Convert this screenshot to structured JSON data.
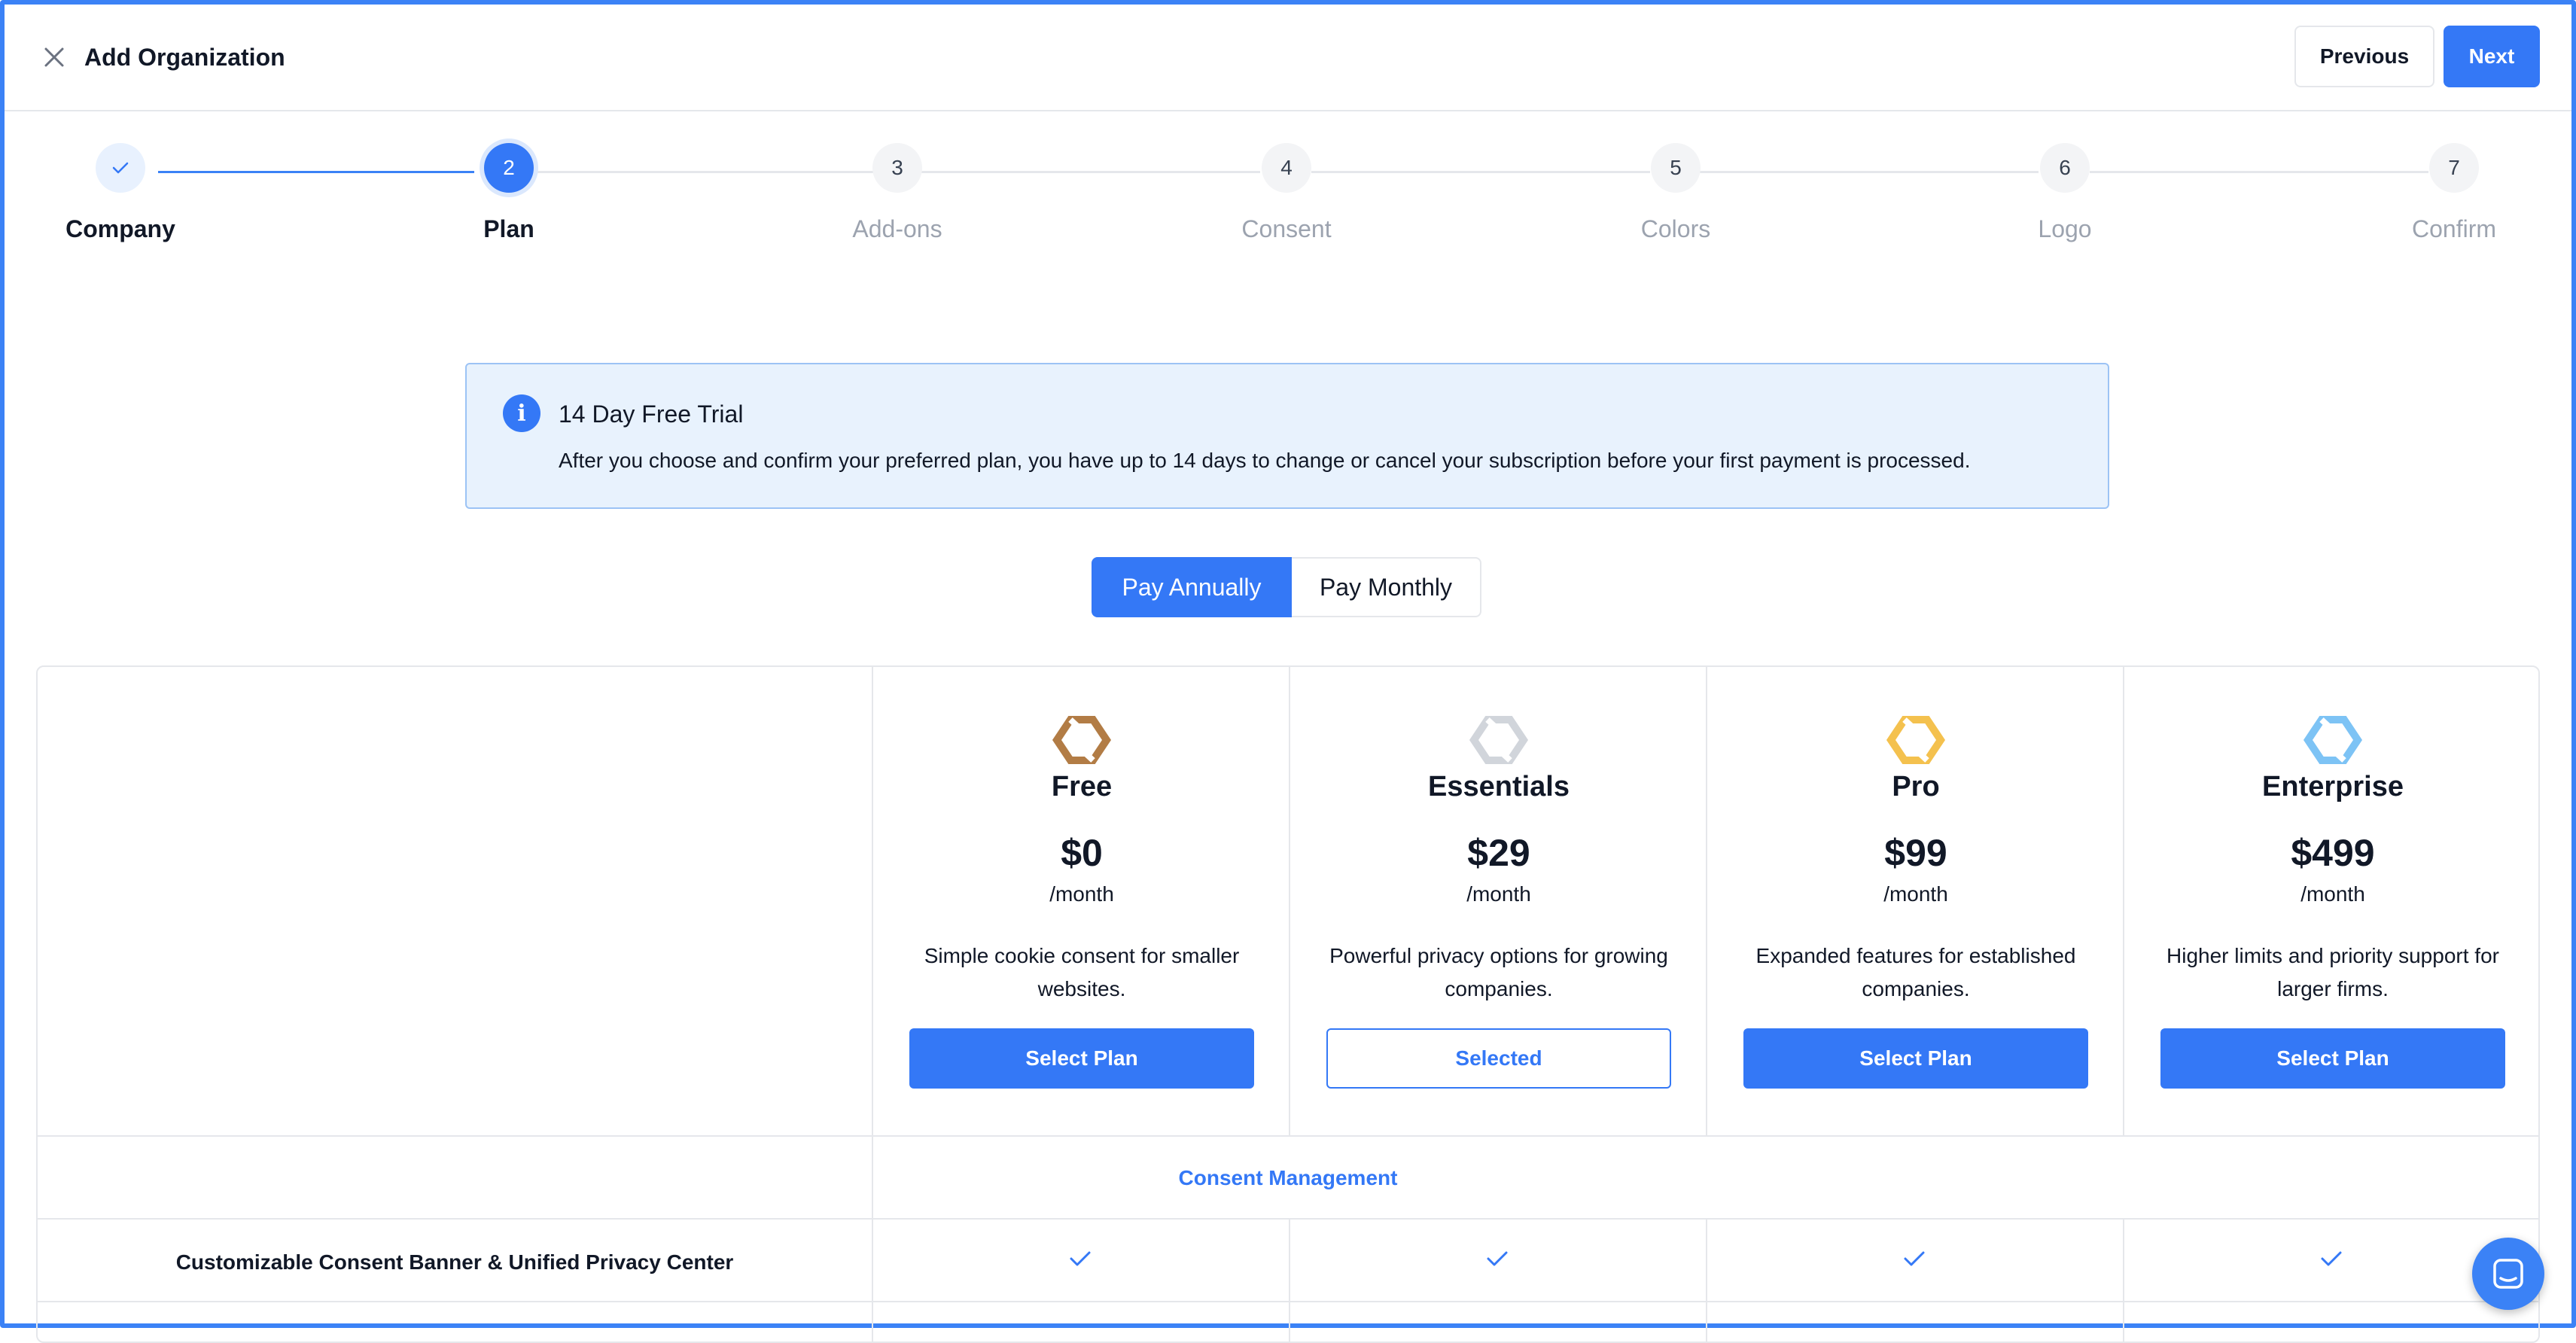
{
  "header": {
    "title": "Add Organization",
    "previous_label": "Previous",
    "next_label": "Next"
  },
  "stepper": {
    "steps": [
      {
        "number": "1",
        "label": "Company",
        "state": "done"
      },
      {
        "number": "2",
        "label": "Plan",
        "state": "current"
      },
      {
        "number": "3",
        "label": "Add-ons",
        "state": "upcoming"
      },
      {
        "number": "4",
        "label": "Consent",
        "state": "upcoming"
      },
      {
        "number": "5",
        "label": "Colors",
        "state": "upcoming"
      },
      {
        "number": "6",
        "label": "Logo",
        "state": "upcoming"
      },
      {
        "number": "7",
        "label": "Confirm",
        "state": "upcoming"
      }
    ]
  },
  "banner": {
    "icon": "info-icon",
    "icon_glyph": "i",
    "title": "14 Day Free Trial",
    "text": "After you choose and confirm your preferred plan, you have up to 14 days to change or cancel your subscription before your first payment is processed."
  },
  "billing": {
    "annual_label": "Pay Annually",
    "monthly_label": "Pay Monthly",
    "selected": "annual"
  },
  "plans": [
    {
      "name": "Free",
      "price": "$0",
      "period": "/month",
      "description": "Simple cookie consent for smaller websites.",
      "button": "Select Plan",
      "selected": false,
      "icon_color": "#b27c45"
    },
    {
      "name": "Essentials",
      "price": "$29",
      "period": "/month",
      "description": "Powerful privacy options for growing companies.",
      "button": "Selected",
      "selected": true,
      "icon_color": "#d1d5db"
    },
    {
      "name": "Pro",
      "price": "$99",
      "period": "/month",
      "description": "Expanded features for established companies.",
      "button": "Select Plan",
      "selected": false,
      "icon_color": "#f4c14e"
    },
    {
      "name": "Enterprise",
      "price": "$499",
      "period": "/month",
      "description": "Higher limits and priority support for larger firms.",
      "button": "Select Plan",
      "selected": false,
      "icon_color": "#7dc3f5"
    }
  ],
  "features": {
    "section_title": "Consent Management",
    "rows": [
      {
        "label": "Customizable Consent Banner & Unified Privacy Center",
        "included": [
          true,
          true,
          true,
          true
        ]
      }
    ]
  },
  "colors": {
    "accent": "#3478f6",
    "border": "#e5e7eb",
    "banner_bg": "#e8f2fd"
  },
  "chat": {
    "icon": "chat-icon"
  }
}
